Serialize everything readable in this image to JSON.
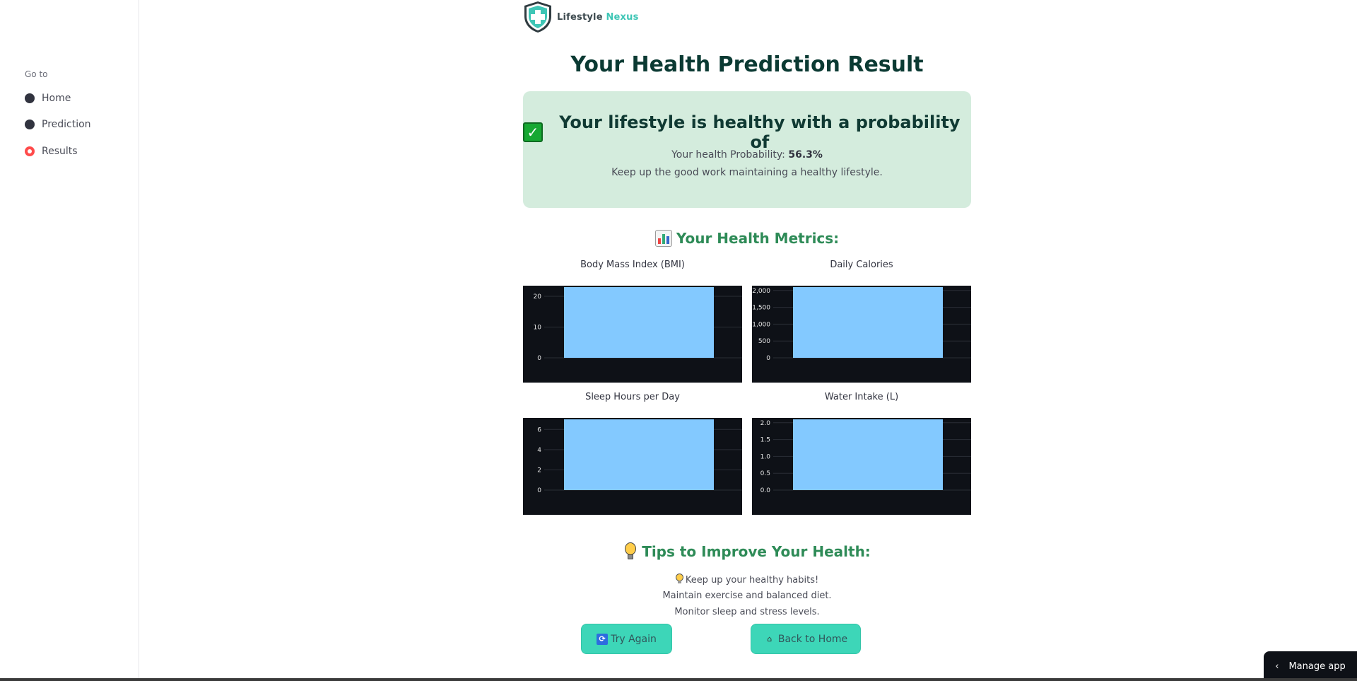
{
  "sidebar": {
    "heading": "Go to",
    "items": [
      {
        "label": "Home",
        "selected": false
      },
      {
        "label": "Prediction",
        "selected": false
      },
      {
        "label": "Results",
        "selected": true
      }
    ]
  },
  "logo": {
    "brand_a": "Lifestyle",
    "brand_b": "Nexus",
    "icon": "shield-cross-icon"
  },
  "page_title": "Your Health Prediction Result",
  "result": {
    "headline": "Your lifestyle is healthy with a probability of",
    "icon": "check-mark-icon",
    "prob_label": "Your health Probability:",
    "prob_value": "56.3%",
    "message": "Keep up the good work maintaining a healthy lifestyle.",
    "colors": {
      "bg": "#d4ecdd",
      "check": "#16a832"
    }
  },
  "metrics_title": "Your Health Metrics:",
  "chart_data": [
    {
      "type": "bar",
      "title": "Body Mass Index (BMI)",
      "categories": [
        ""
      ],
      "values": [
        23
      ],
      "yticks": [
        "0",
        "10",
        "20"
      ],
      "ylim": [
        0,
        23
      ],
      "color": "#83c9ff"
    },
    {
      "type": "bar",
      "title": "Daily Calories",
      "categories": [
        ""
      ],
      "values": [
        2100
      ],
      "yticks": [
        "0",
        "500",
        "1,000",
        "1,500",
        "2,000"
      ],
      "ylim": [
        0,
        2100
      ],
      "color": "#83c9ff"
    },
    {
      "type": "bar",
      "title": "Sleep Hours per Day",
      "categories": [
        ""
      ],
      "values": [
        7
      ],
      "yticks": [
        "0",
        "2",
        "4",
        "6"
      ],
      "ylim": [
        0,
        7
      ],
      "color": "#83c9ff"
    },
    {
      "type": "bar",
      "title": "Water Intake (L)",
      "categories": [
        ""
      ],
      "values": [
        2.1
      ],
      "yticks": [
        "0.0",
        "0.5",
        "1.0",
        "1.5",
        "2.0"
      ],
      "ylim": [
        0,
        2.1
      ],
      "color": "#83c9ff"
    }
  ],
  "tips": {
    "title": "Tips to Improve Your Health:",
    "lines": [
      "Keep up your healthy habits!",
      "Maintain exercise and balanced diet.",
      "Monitor sleep and stress levels."
    ]
  },
  "buttons": {
    "try_again": "Try Again",
    "back_home": "Back to Home"
  },
  "manage_app": "Manage app"
}
